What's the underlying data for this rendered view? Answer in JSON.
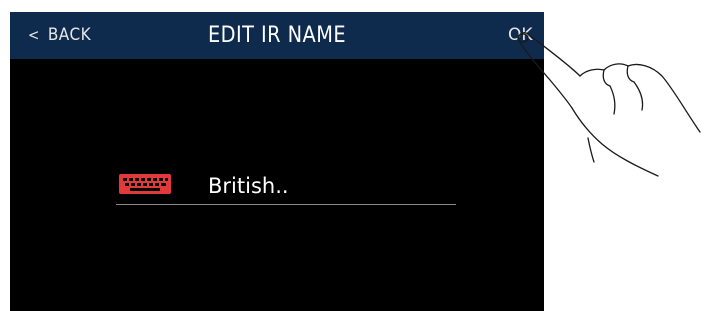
{
  "header": {
    "back_label": "BACK",
    "back_chevron": "<",
    "title": "EDIT IR NAME",
    "ok_label": "OK"
  },
  "name_field": {
    "value": "British.."
  },
  "colors": {
    "header_bg": "#0e2b4e",
    "screen_bg": "#000000",
    "keyboard_icon": "#e23a3a"
  },
  "icons": {
    "keyboard": "keyboard-icon",
    "hand": "pointing-hand-icon"
  }
}
